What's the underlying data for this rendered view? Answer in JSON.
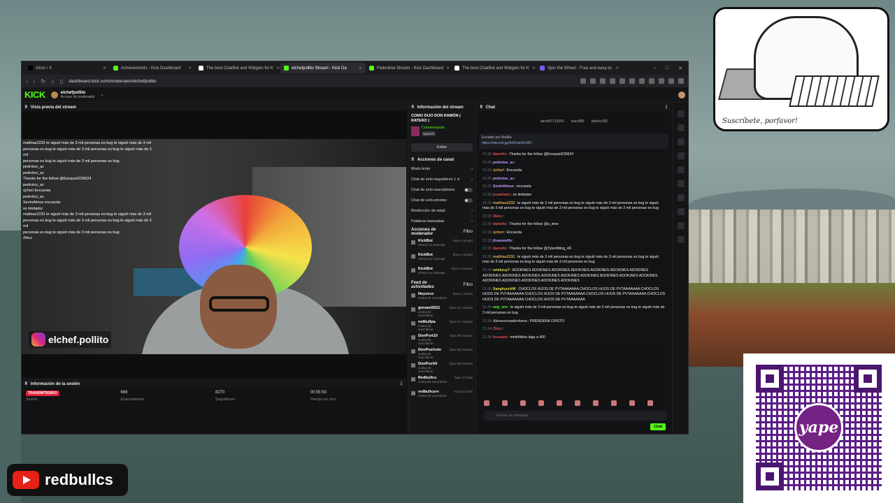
{
  "overlay": {
    "mascot_caption": "Suscríbete, porfavor!",
    "youtube_handle": "redbullcs",
    "instagram_handle": "elchef.pollito",
    "qr_brand": "yape"
  },
  "browser": {
    "tabs": [
      {
        "label": "Inicio / X",
        "color": "#000000"
      },
      {
        "label": "Achievements - Kick Dashboard",
        "color": "#53fc18"
      },
      {
        "label": "The best ChatBot and Widgets for K",
        "color": "#ffffff"
      },
      {
        "label": "elchefpollito Stream - Kick Da",
        "color": "#53fc18"
      },
      {
        "label": "Federikita Stream - Kick Dashboard",
        "color": "#53fc18"
      },
      {
        "label": "The best ChatBot and Widgets for K",
        "color": "#ffffff"
      },
      {
        "label": "Spin the Wheel - Free and easy-to-",
        "color": "#7a5af8"
      }
    ],
    "active_tab": 3,
    "url": "dashboard.kick.com/moderator/elchefpollito"
  },
  "app": {
    "logo": "KICK",
    "channel_name": "elchefpollito",
    "channel_role": "Acceso de moderador"
  },
  "stream_preview": {
    "title": "Vista previa del stream",
    "overlay_chat": [
      "mathias2232 te siguió más de 3 mil personas es bug te siguió más de 3 mil",
      "personas es bug te siguió más de 3 mil personas es bug te siguió más de 3 mil",
      "personas es bug te siguió más de 3 mil personas es bug",
      "pedroloz_ac",
      "pedroloz_ac",
      "Thanks for the follow @Ezequiel230624",
      "pedroloz_ac",
      "rjcheri Encuesta",
      "pedroloz_ac",
      "SevInAlmus encuesta",
      "es limitador",
      "mathias2232 te siguió más de 3 mil personas es bug te siguió más de 3 mil",
      "personas es bug te siguió más de 3 mil personas es bug te siguió más de 3 mil",
      "personas es bug te siguió más de 3 mil personas es bug",
      "Zktcz"
    ]
  },
  "session": {
    "title": "Información de la sesión",
    "live_badge": "TRANSMITIENDO",
    "stats": [
      {
        "value": "",
        "label": "Sesión"
      },
      {
        "value": "669",
        "label": "Espectadores"
      },
      {
        "value": "8270",
        "label": "Seguidores"
      },
      {
        "value": "00:55:59",
        "label": "Tiempo en vivo"
      }
    ]
  },
  "stream_info": {
    "title": "Información del stream",
    "stream_title": "COMO DIJO DON RAMÓN ( RATERO )",
    "category": "Conversando",
    "tag": "Spanish",
    "edit_label": "Editar"
  },
  "channel_actions": {
    "title": "Acciones de canal",
    "items": [
      {
        "label": "Modo lento",
        "kind": "arrow"
      },
      {
        "label": "Chat de solo-seguidores 1 d",
        "kind": "arrow"
      },
      {
        "label": "Chat de solo-suscriptores",
        "kind": "toggle"
      },
      {
        "label": "Chat de solo-emotes",
        "kind": "toggle"
      },
      {
        "label": "Restricción de edad",
        "kind": "arrow"
      },
      {
        "label": "Palabras baneadas",
        "kind": "arrow"
      }
    ]
  },
  "mod_actions": {
    "title": "Acciones de moderador",
    "filter": "Filtro",
    "items": [
      {
        "name": "KickBot",
        "desc": "eliminó un mensaje",
        "time": "hace 1 minuto"
      },
      {
        "name": "KickBot",
        "desc": "eliminó un mensaje",
        "time": "hace 1 minuto"
      },
      {
        "name": "KickBot",
        "desc": "eliminó un mensaje",
        "time": "hace 2 minutos"
      }
    ]
  },
  "activity_feed": {
    "title": "Feed de actividades",
    "filter": "Filtro",
    "items": [
      {
        "name": "Neyvexx",
        "desc": "acaba de suscribirse",
        "time": "hace 1 minuto"
      },
      {
        "name": "giovani9321",
        "desc": "acaba de suscribirse",
        "time": "hace 24 minutos"
      },
      {
        "name": "redbullpa",
        "desc": "acaba de suscribirse",
        "time": "hace 37 minutos"
      },
      {
        "name": "DonPort10",
        "desc": "acaba de suscribirse",
        "time": "hace 38 minutos"
      },
      {
        "name": "DonPostrulo",
        "desc": "acaba de suscribirse",
        "time": "hace 48 minutos"
      },
      {
        "name": "DonPuch0",
        "desc": "acaba de suscribirse",
        "time": "hace 49 minutos"
      },
      {
        "name": "Redbullcs",
        "desc": "acaba de suscribirse",
        "time": "hace 2 horas"
      },
      {
        "name": "redbullcsrv",
        "desc": "acaba de suscribirse",
        "time": "hace 2 horas"
      }
    ]
  },
  "chat": {
    "title": "Chat",
    "leaderboard": [
      "david07113003",
      "luisvill85",
      "alberto282"
    ],
    "pinned_by": "Enviado por BotRix",
    "pinned_link": "https://discord.gg/5eKhaGRcMC",
    "messages": [
      {
        "ts": "21:33",
        "user": "danieltx",
        "color": "#e94b4b",
        "text": "Thanks for the follow @Ezequiel230624"
      },
      {
        "ts": "21:33",
        "user": "pedroloz_ac",
        "color": "#c59cff",
        "text": ""
      },
      {
        "ts": "21:33",
        "user": "rjcheri",
        "color": "#e0a84e",
        "text": "Encuesta"
      },
      {
        "ts": "21:33",
        "user": "pedroloz_ac",
        "color": "#c59cff",
        "text": ""
      },
      {
        "ts": "21:33",
        "user": "SevInAlmus",
        "color": "#c59cff",
        "text": "encuesta"
      },
      {
        "ts": "21:33",
        "user": "jcuadrado",
        "color": "#e94b4b",
        "text": "es limitador"
      },
      {
        "ts": "21:33",
        "user": "mathias2232",
        "color": "#e0a84e",
        "text": "te siguió más de 3 mil personas es bug te siguió más de 3 mil personas es bug te siguió más de 3 mil personas es bug te siguió más de 3 mil personas es bug te siguió más de 3 mil personas es bug"
      },
      {
        "ts": "21:33",
        "user": "Zktcz",
        "color": "#e94b4b",
        "text": ""
      },
      {
        "ts": "21:33",
        "user": "danieltx",
        "color": "#e94b4b",
        "text": "Thanks for the follow @a_imer"
      },
      {
        "ts": "21:33",
        "user": "rjcheri",
        "color": "#e0a84e",
        "text": "Encuesta"
      },
      {
        "ts": "21:33",
        "user": "jhuanwolfe",
        "color": "#c59cff",
        "text": ""
      },
      {
        "ts": "21:33",
        "user": "danieltx",
        "color": "#e94b4b",
        "text": "Thanks for the follow @Tylerdbling_48"
      },
      {
        "ts": "21:33",
        "user": "mathias2232",
        "color": "#e0a84e",
        "text": "te siguió más de 3 mil personas es bug te siguió más de 3 mil personas es bug te siguió más de 3 mil personas es bug te siguió más de 3 mil personas es bug"
      },
      {
        "ts": "21:34",
        "user": "orlekzuy7",
        "color": "#e0e04e",
        "text": "ADOKINES ADOKINES ADOKINES ADOKINES ADOKINES ADOKINES ADOKINES ADOKINES ADOKINES ADOKINES ADOKINES ADOKINES ADOKINES ADOKINES ADOKINES ADOKINES ADOKINES ADOKINES ADOKINES ADOKINES ADOKINES"
      },
      {
        "ts": "21:34",
        "user": "SanghyuckW",
        "color": "#e0e04e",
        "text": "CHOCLOS HIJOS DE PVTAAAAAAA CHOCLOS HIJOS DE PVTAAAAAAA CHOCLOS HIJOS DE PVTAAAAAAA CHOCLOS HIJOS DE PVTAAAAAAA CHOCLOS HIJOS DE PVTAAAAAAA CHOCLOS HIJOS DE PVTAAAAAAA CHOCLOS HIJOS DE PVTAAAAAAA"
      },
      {
        "ts": "21:34",
        "user": "ang_xnx",
        "color": "#53fc18",
        "text": "te siguió más de 3 mil personas es bug te siguió más de 3 mil personas es bug te siguió más de 3 mil personas es bug"
      },
      {
        "ts": "21:34",
        "user": "Alonsocreadorlvera",
        "color": "#bbbbbb",
        "text": "PRENDERA CRISTO"
      },
      {
        "ts": "21:34",
        "user": "Zktcz",
        "color": "#e94b4b",
        "text": ""
      },
      {
        "ts": "21:34",
        "user": "ksosadx",
        "color": "#e94b4b",
        "text": "minifrikitos baja a 400"
      }
    ],
    "input_placeholder": "Enviar un mensaje",
    "send_label": "Chat"
  }
}
